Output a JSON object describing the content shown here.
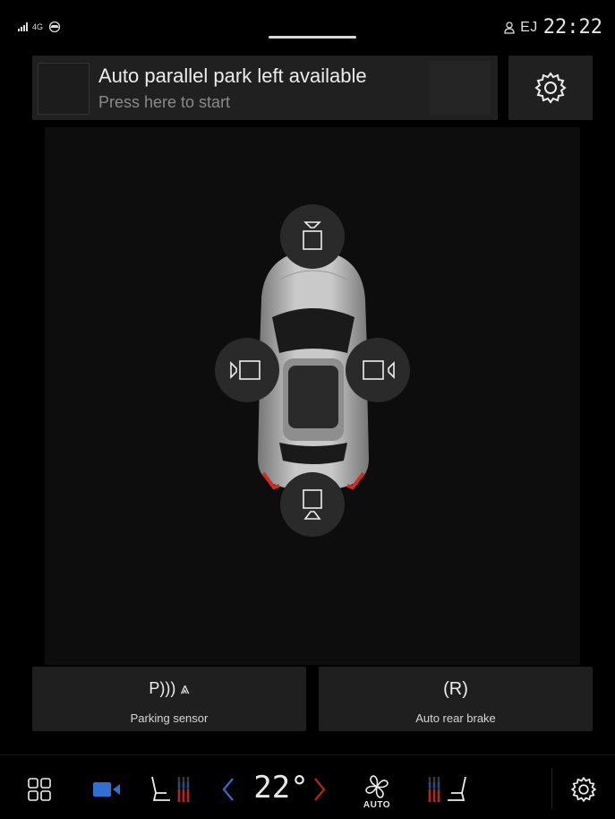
{
  "status_bar": {
    "network": "4G",
    "profile": "EJ",
    "time": "22:22"
  },
  "notification": {
    "title": "Auto parallel park left available",
    "subtitle": "Press here to start"
  },
  "camera_view": {
    "buttons": [
      "front-camera",
      "left-camera",
      "right-camera",
      "rear-camera"
    ]
  },
  "functions": {
    "parking_sensor": {
      "icon_text": "P))) ⩓",
      "label": "Parking sensor"
    },
    "auto_rear_brake": {
      "icon_text": "(R)",
      "label": "Auto rear brake"
    }
  },
  "climate": {
    "temperature": "22°",
    "fan_mode": "AUTO"
  },
  "colors": {
    "accent_blue": "#2f6fd1",
    "brake_red": "#d42a1f",
    "temp_left": "#1f4e8c",
    "temp_right": "#b3271c"
  }
}
